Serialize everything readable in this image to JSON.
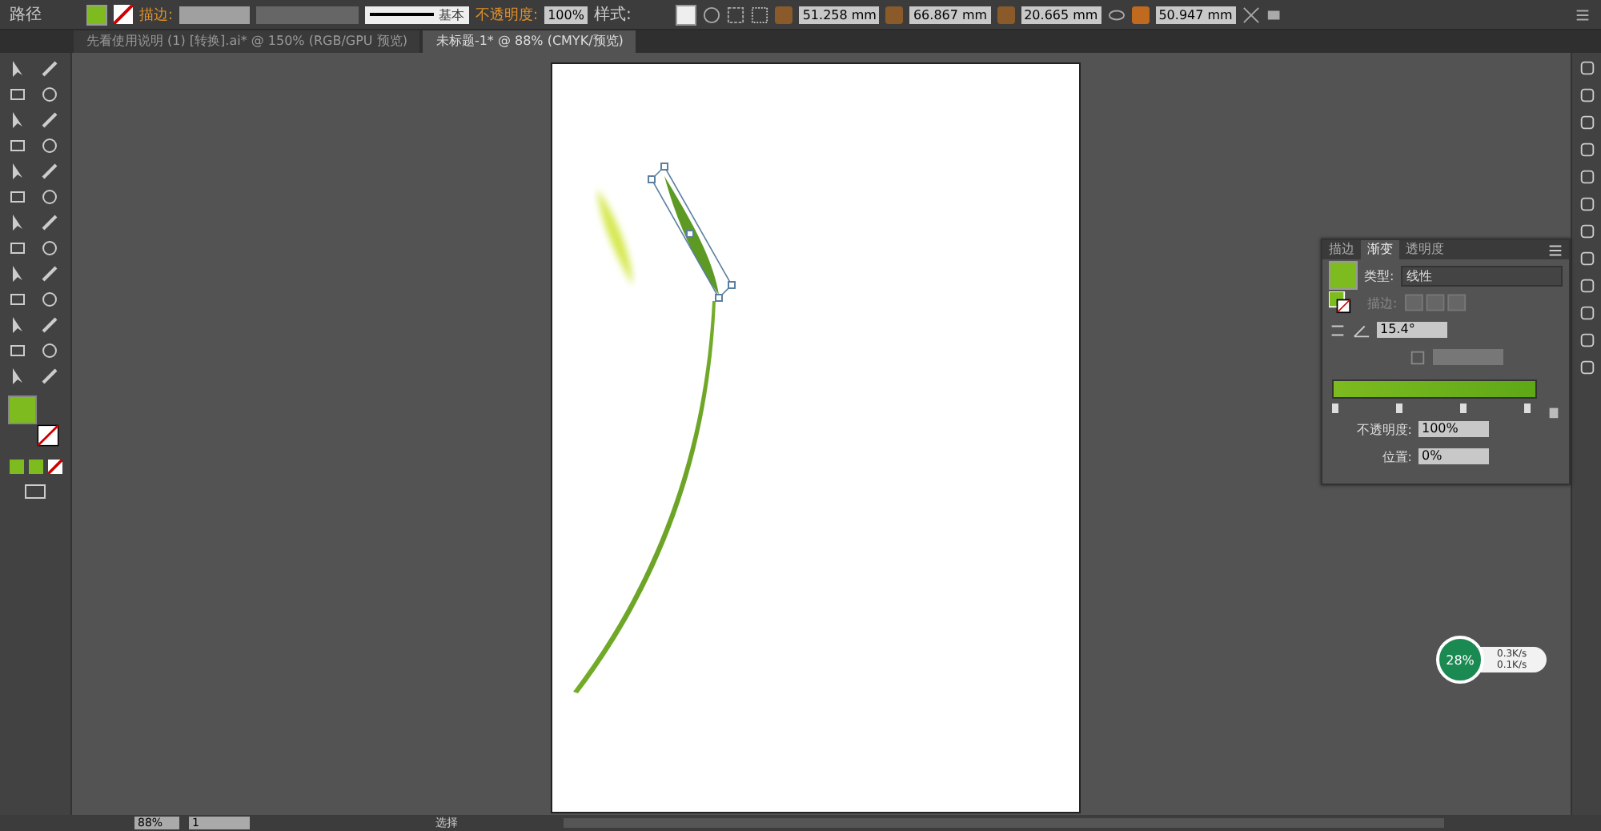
{
  "control_bar": {
    "object_type": "路径",
    "stroke_label": "描边:",
    "brush": "基本",
    "opacity_label": "不透明度:",
    "opacity": "100%",
    "style_label": "样式:",
    "x": "51.258 mm",
    "y": "66.867 mm",
    "width": "20.665 mm",
    "height": "50.947 mm"
  },
  "tabs": [
    {
      "label": "先看使用说明 (1) [转换].ai* @ 150% (RGB/GPU 预览)",
      "selected": false
    },
    {
      "label": "未标题-1* @ 88% (CMYK/预览)",
      "selected": true
    }
  ],
  "gradient_panel": {
    "tabs": [
      {
        "label": "描边",
        "selected": false
      },
      {
        "label": "渐变",
        "selected": true
      },
      {
        "label": "透明度",
        "selected": false
      }
    ],
    "type_label": "类型:",
    "type": "线性",
    "stroke_label": "描边:",
    "angle": "15.4°",
    "opacity_label": "不透明度:",
    "opacity": "100%",
    "location_label": "位置:",
    "location": "0%"
  },
  "status_bar": {
    "zoom": "88%",
    "artboard": "1",
    "tool": "选择"
  },
  "network_widget": {
    "cpu": "28%",
    "upload": "0.3K/s",
    "download": "0.1K/s"
  }
}
